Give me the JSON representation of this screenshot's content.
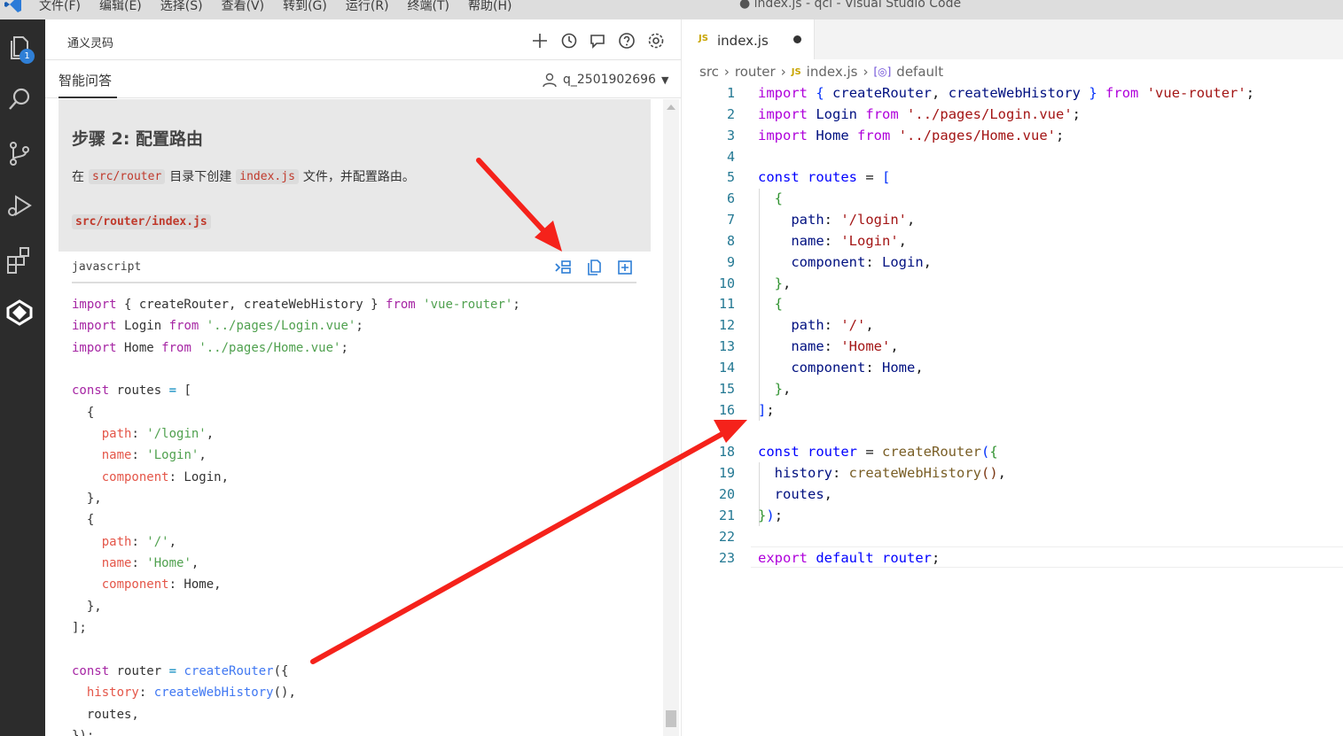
{
  "window": {
    "title": "● index.js - qcl - Visual Studio Code",
    "menu": [
      "文件(F)",
      "编辑(E)",
      "选择(S)",
      "查看(V)",
      "转到(G)",
      "运行(R)",
      "终端(T)",
      "帮助(H)"
    ]
  },
  "activity_bar": {
    "items": [
      "files-icon",
      "search-icon",
      "source-control-icon",
      "run-debug-icon",
      "extensions-icon",
      "tongyi-lingma-icon"
    ],
    "explorer_badge": "1"
  },
  "panel": {
    "title": "通义灵码",
    "header_icons": [
      "plus-icon",
      "history-icon",
      "feedback-icon",
      "help-icon",
      "settings-icon"
    ],
    "tab": "智能问答",
    "user": "q_2501902696",
    "step_title": "步骤 2: 配置路由",
    "desc_prefix": "在",
    "desc_code1": "src/router",
    "desc_mid": "目录下创建",
    "desc_code2": "index.js",
    "desc_suffix": "文件，并配置路由。",
    "file_path": "src/router/index.js",
    "code_lang": "javascript",
    "code_actions": [
      "insert-code-icon",
      "copy-icon",
      "new-file-icon"
    ]
  },
  "editor": {
    "tab_icon": "JS",
    "tab_name": "index.js",
    "breadcrumb": [
      "src",
      "router",
      "index.js",
      "default"
    ],
    "line_count": 23
  },
  "colors": {
    "annotation_arrow": "#f5221b",
    "activity_bg": "#2c2c2c",
    "accent": "#2f7fd6"
  }
}
